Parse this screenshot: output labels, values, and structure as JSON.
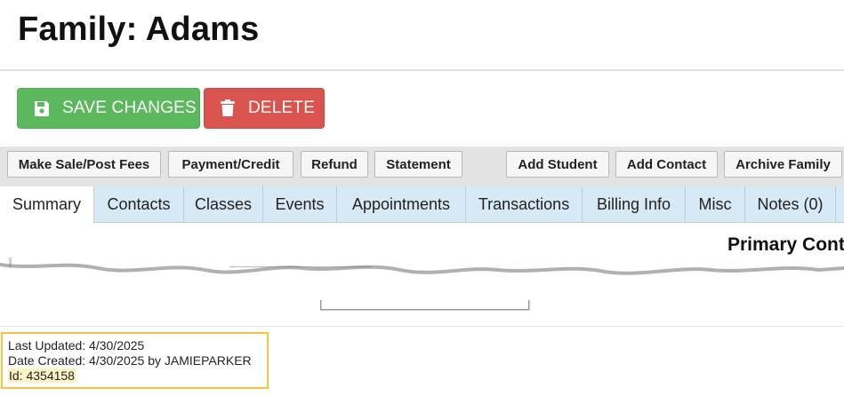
{
  "page": {
    "title": "Family: Adams"
  },
  "actions": {
    "save_label": "SAVE CHANGES",
    "delete_label": "DELETE",
    "save_color": "#5cb85c",
    "delete_color": "#d9534f"
  },
  "toolbar": {
    "buttons": [
      "Make Sale/Post Fees",
      "Payment/Credit",
      "Refund",
      "Statement",
      "Add Student",
      "Add Contact",
      "Archive Family"
    ]
  },
  "tabs": {
    "items": [
      "Summary",
      "Contacts",
      "Classes",
      "Events",
      "Appointments",
      "Transactions",
      "Billing Info",
      "Misc",
      "Notes (0)"
    ],
    "active": "Summary"
  },
  "summary": {
    "section_heading": "Primary Cont"
  },
  "record_info": {
    "last_updated": "Last Updated: 4/30/2025",
    "date_created": "Date Created: 4/30/2025 by JAMIEPARKER",
    "id": "Id: 4354158"
  },
  "icons": {
    "save": "floppy-disk-icon",
    "delete": "trash-can-icon"
  }
}
